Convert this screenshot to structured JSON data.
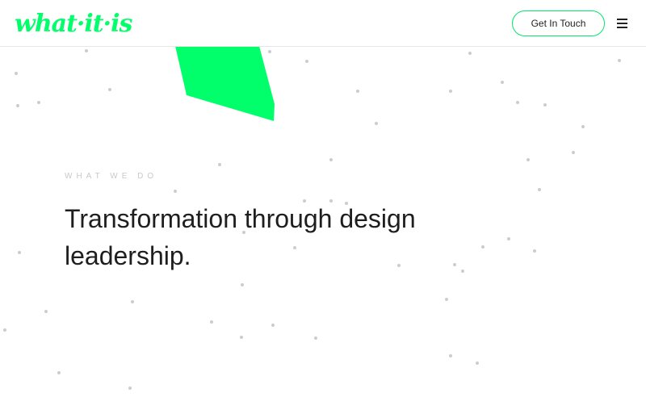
{
  "header": {
    "logo_text": "what·it·is",
    "cta_label": "Get In Touch",
    "menu_icon": "hamburger-menu-icon"
  },
  "hero": {
    "eyebrow": "WHAT WE DO",
    "headline": "Transformation through design leadership."
  },
  "colors": {
    "accent": "#00ff6a",
    "text": "#1e1e1e",
    "eyebrow": "#c9c9c9",
    "dot": "#cccccc"
  }
}
